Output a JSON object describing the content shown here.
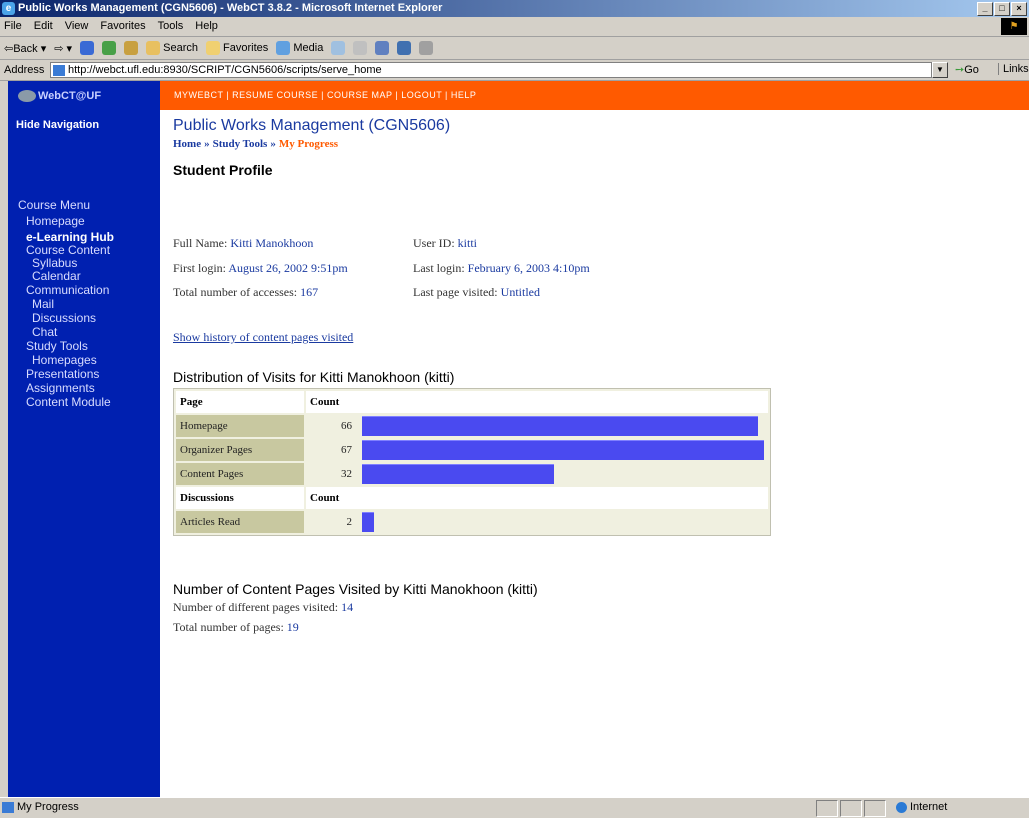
{
  "window": {
    "title": "Public Works Management (CGN5606) - WebCT 3.8.2 - Microsoft Internet Explorer",
    "controls": [
      "_",
      "□",
      "×"
    ]
  },
  "menubar": {
    "items": [
      "File",
      "Edit",
      "View",
      "Favorites",
      "Tools",
      "Help"
    ]
  },
  "toolbar": {
    "back": "Back",
    "search": "Search",
    "favorites": "Favorites",
    "media": "Media"
  },
  "addressbar": {
    "label": "Address",
    "url": "http://webct.ufl.edu:8930/SCRIPT/CGN5606/scripts/serve_home",
    "go": "Go",
    "links": "Links"
  },
  "webct": {
    "brand": "WebCT@UF",
    "topnav": "MYWEBCT  |  RESUME COURSE  |  COURSE MAP  |  LOGOUT  |  HELP"
  },
  "sidebar": {
    "hide_nav": "Hide Navigation",
    "menu_title": "Course Menu",
    "items": [
      {
        "label": "Homepage"
      },
      {
        "label": "e-Learning Hub"
      },
      {
        "label": "Course Content"
      },
      {
        "label": "Syllabus"
      },
      {
        "label": "Calendar"
      },
      {
        "label": "Communication"
      },
      {
        "label": "Mail"
      },
      {
        "label": "Discussions"
      },
      {
        "label": "Chat"
      },
      {
        "label": "Study Tools"
      },
      {
        "label": "Homepages"
      },
      {
        "label": "Presentations"
      },
      {
        "label": "Assignments"
      },
      {
        "label": "Content Module"
      }
    ]
  },
  "content": {
    "title": "Public Works Management (CGN5606)",
    "breadcrumb": [
      "Home",
      "Study Tools",
      "My Progress"
    ],
    "section_title": "Student Profile",
    "profile": {
      "full_name_label": "Full Name:",
      "full_name": "Kitti Manokhoon",
      "user_id_label": "User ID:",
      "user_id": "kitti",
      "first_login_label": "First login:",
      "first_login": "August 26, 2002 9:51pm",
      "last_login_label": "Last login:",
      "last_login": "February 6, 2003 4:10pm",
      "accesses_label": "Total number of accesses:",
      "accesses": "167",
      "last_page_label": "Last page visited:",
      "last_page": "Untitled"
    },
    "history_link": "Show history of content pages visited",
    "distribution_title": "Distribution of Visits for Kitti Manokhoon (kitti)",
    "table": {
      "col_page": "Page",
      "col_count": "Count",
      "rows": [
        {
          "label": "Homepage",
          "count": "66",
          "fraction": 0.985
        },
        {
          "label": "Organizer Pages",
          "count": "67",
          "fraction": 1.0
        },
        {
          "label": "Content Pages",
          "count": "32",
          "fraction": 0.478
        }
      ],
      "col_discussions": "Discussions",
      "col_count2": "Count",
      "rows2": [
        {
          "label": "Articles Read",
          "count": "2",
          "fraction": 0.03
        }
      ],
      "bar_color": "#4a4af0"
    },
    "pages_title": "Number of Content Pages Visited by Kitti Manokhoon (kitti)",
    "pages_visited_label": "Number of different pages visited:",
    "pages_visited": "14",
    "pages_total_label": "Total number of pages:",
    "pages_total": "19"
  },
  "statusbar": {
    "text": "My Progress",
    "zone": "Internet"
  }
}
